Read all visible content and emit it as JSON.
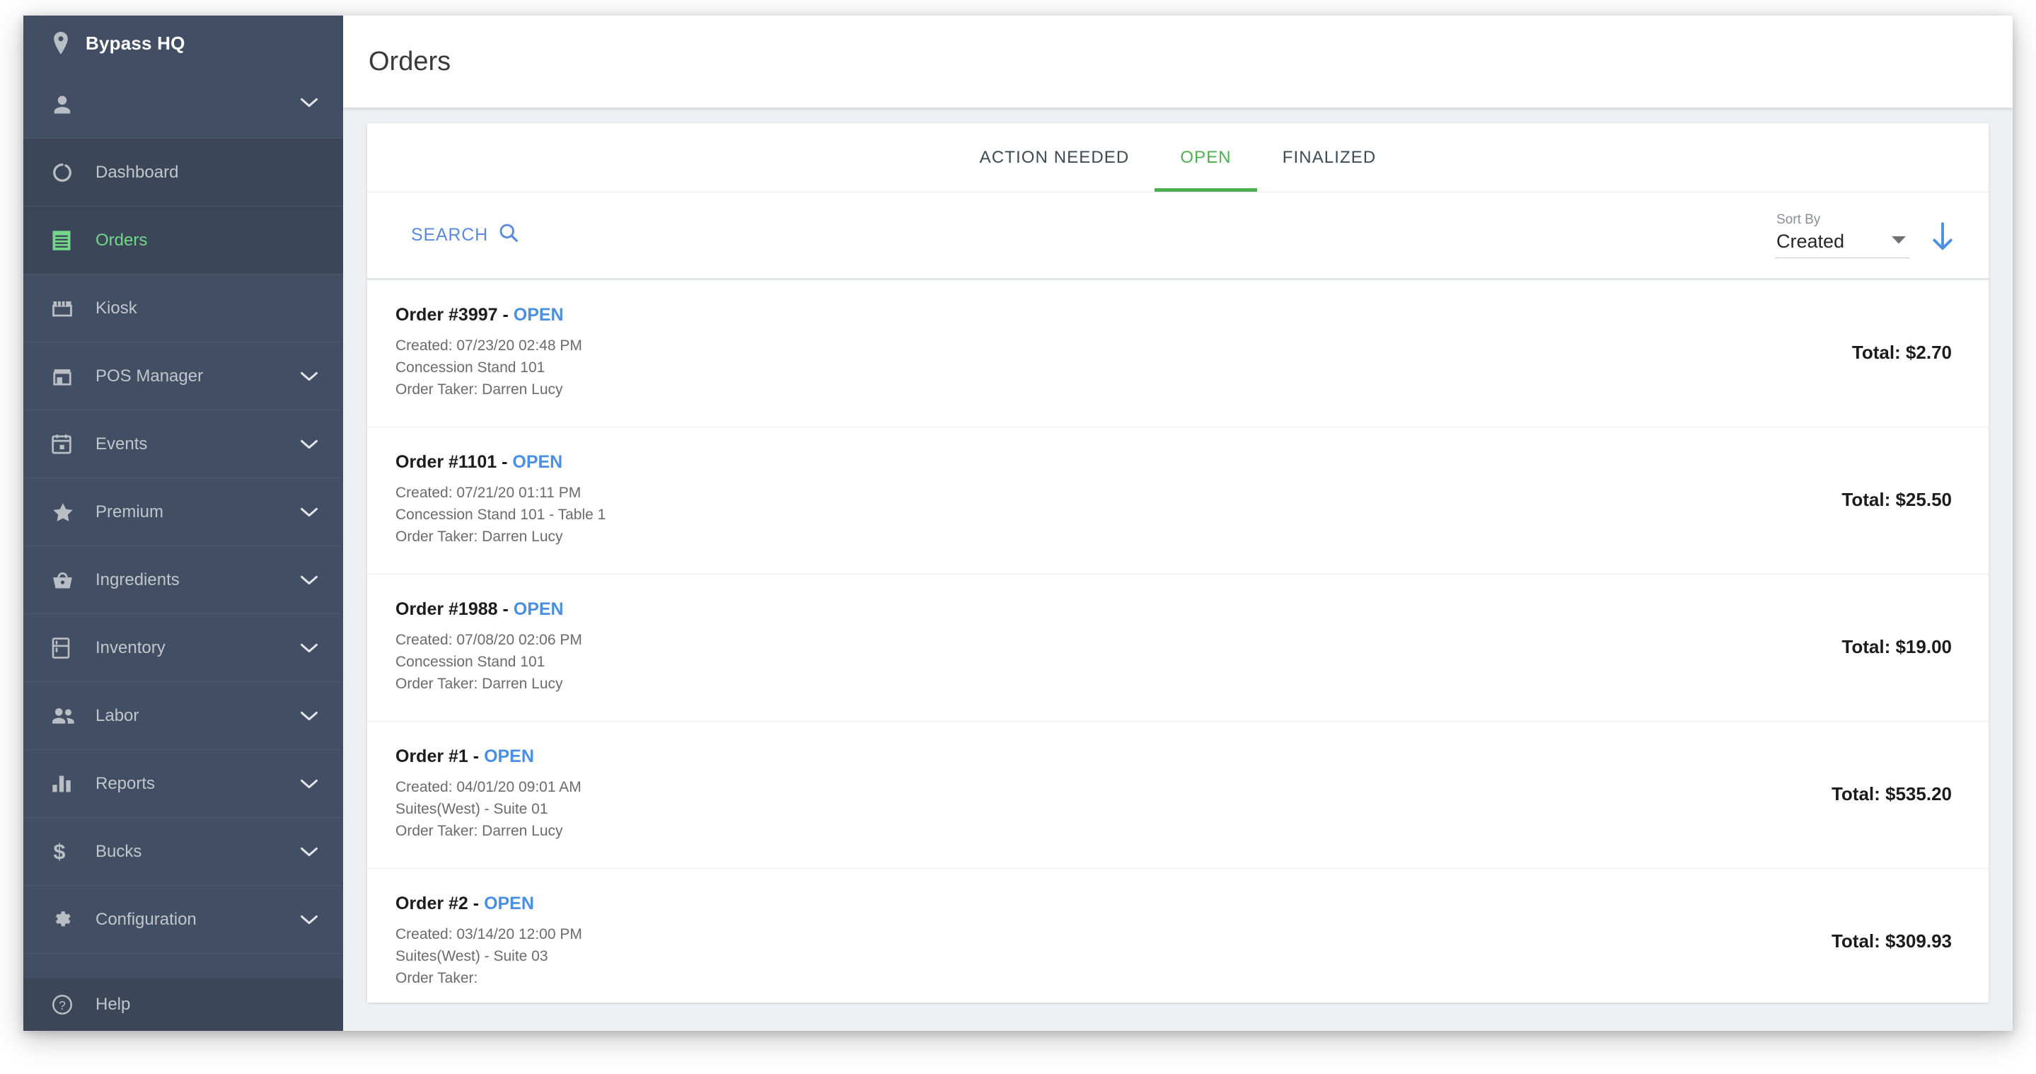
{
  "sidebar": {
    "brand": {
      "label": "Bypass HQ",
      "icon": "location-pin-icon"
    },
    "account": {
      "label": "",
      "icon": "person-icon",
      "chevron": "chevron-down-icon"
    },
    "items": [
      {
        "label": "Dashboard",
        "icon": "dashboard-donut-icon",
        "chevron": false,
        "active": false,
        "highlight": true
      },
      {
        "label": "Orders",
        "icon": "receipt-icon",
        "chevron": false,
        "active": true,
        "highlight": true
      },
      {
        "label": "Kiosk",
        "icon": "storefront-icon",
        "chevron": false,
        "active": false,
        "highlight": false
      },
      {
        "label": "POS Manager",
        "icon": "store-icon",
        "chevron": true,
        "active": false,
        "highlight": false
      },
      {
        "label": "Events",
        "icon": "calendar-icon",
        "chevron": true,
        "active": false,
        "highlight": false
      },
      {
        "label": "Premium",
        "icon": "star-icon",
        "chevron": true,
        "active": false,
        "highlight": false
      },
      {
        "label": "Ingredients",
        "icon": "basket-icon",
        "chevron": true,
        "active": false,
        "highlight": false
      },
      {
        "label": "Inventory",
        "icon": "fridge-icon",
        "chevron": true,
        "active": false,
        "highlight": false
      },
      {
        "label": "Labor",
        "icon": "people-icon",
        "chevron": true,
        "active": false,
        "highlight": false
      },
      {
        "label": "Reports",
        "icon": "bar-chart-icon",
        "chevron": true,
        "active": false,
        "highlight": false
      },
      {
        "label": "Bucks",
        "icon": "dollar-sign-icon",
        "chevron": true,
        "active": false,
        "highlight": false
      },
      {
        "label": "Configuration",
        "icon": "gear-icon",
        "chevron": true,
        "active": false,
        "highlight": false
      }
    ],
    "help": {
      "label": "Help",
      "icon": "help-circle-icon"
    }
  },
  "header": {
    "title": "Orders"
  },
  "tabs": [
    {
      "label": "ACTION NEEDED",
      "active": false
    },
    {
      "label": "OPEN",
      "active": true
    },
    {
      "label": "FINALIZED",
      "active": false
    }
  ],
  "filter_bar": {
    "search_label": "SEARCH",
    "search_icon": "magnifier-icon",
    "sort_label": "Sort By",
    "sort_value": "Created",
    "sort_caret_icon": "caret-down-icon",
    "sort_direction_icon": "arrow-down-icon",
    "sort_direction": "descending"
  },
  "orders": [
    {
      "title_prefix": "Order #3997 - ",
      "status": "OPEN",
      "created": "Created: 07/23/20 02:48 PM",
      "location": "Concession Stand 101",
      "taker": "Order Taker: Darren Lucy",
      "total": "Total: $2.70"
    },
    {
      "title_prefix": "Order #1101 - ",
      "status": "OPEN",
      "created": "Created: 07/21/20 01:11 PM",
      "location": "Concession Stand 101 - Table 1",
      "taker": "Order Taker: Darren Lucy",
      "total": "Total: $25.50"
    },
    {
      "title_prefix": "Order #1988 - ",
      "status": "OPEN",
      "created": "Created: 07/08/20 02:06 PM",
      "location": "Concession Stand 101",
      "taker": "Order Taker: Darren Lucy",
      "total": "Total: $19.00"
    },
    {
      "title_prefix": "Order #1 - ",
      "status": "OPEN",
      "created": "Created: 04/01/20 09:01 AM",
      "location": "Suites(West) - Suite 01",
      "taker": "Order Taker: Darren Lucy",
      "total": "Total: $535.20"
    },
    {
      "title_prefix": "Order #2 - ",
      "status": "OPEN",
      "created": "Created: 03/14/20 12:00 PM",
      "location": "Suites(West) - Suite 03",
      "taker": "Order Taker:",
      "total": "Total: $309.93"
    }
  ],
  "colors": {
    "sidebar_bg": "#414e63",
    "sidebar_active_bg": "#3b4758",
    "accent_green": "#4caf50",
    "active_nav_green": "#74d68a",
    "link_blue": "#4a90e2",
    "search_blue": "#5b8ae0",
    "page_bg": "#eef0f3"
  }
}
